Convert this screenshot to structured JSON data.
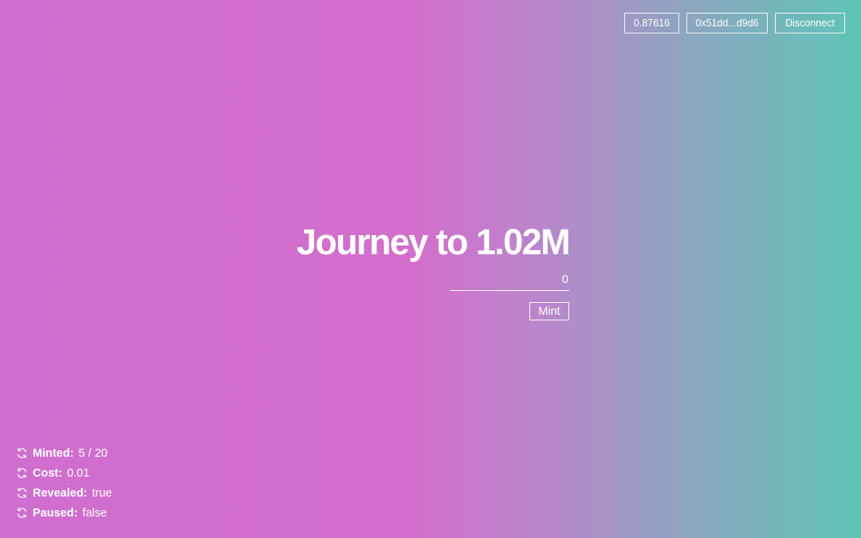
{
  "wallet": {
    "balance": "0.87616",
    "address": "0x51dd...d9d6",
    "disconnect_label": "Disconnect"
  },
  "mint": {
    "title": "Journey to 1.02M",
    "amount_value": "0",
    "mint_label": "Mint"
  },
  "stats": [
    {
      "label": "Minted:",
      "value": "5 / 20",
      "icon": "refresh-icon"
    },
    {
      "label": "Cost:",
      "value": "0.01",
      "icon": "refresh-icon"
    },
    {
      "label": "Revealed:",
      "value": "true",
      "icon": "refresh-icon"
    },
    {
      "label": "Paused:",
      "value": "false",
      "icon": "refresh-icon"
    }
  ],
  "colors": {
    "gradient_start": "#cf6ecf",
    "gradient_mid": "#d26fcc",
    "gradient_end": "#5ec4b6",
    "text": "#ffffff"
  }
}
